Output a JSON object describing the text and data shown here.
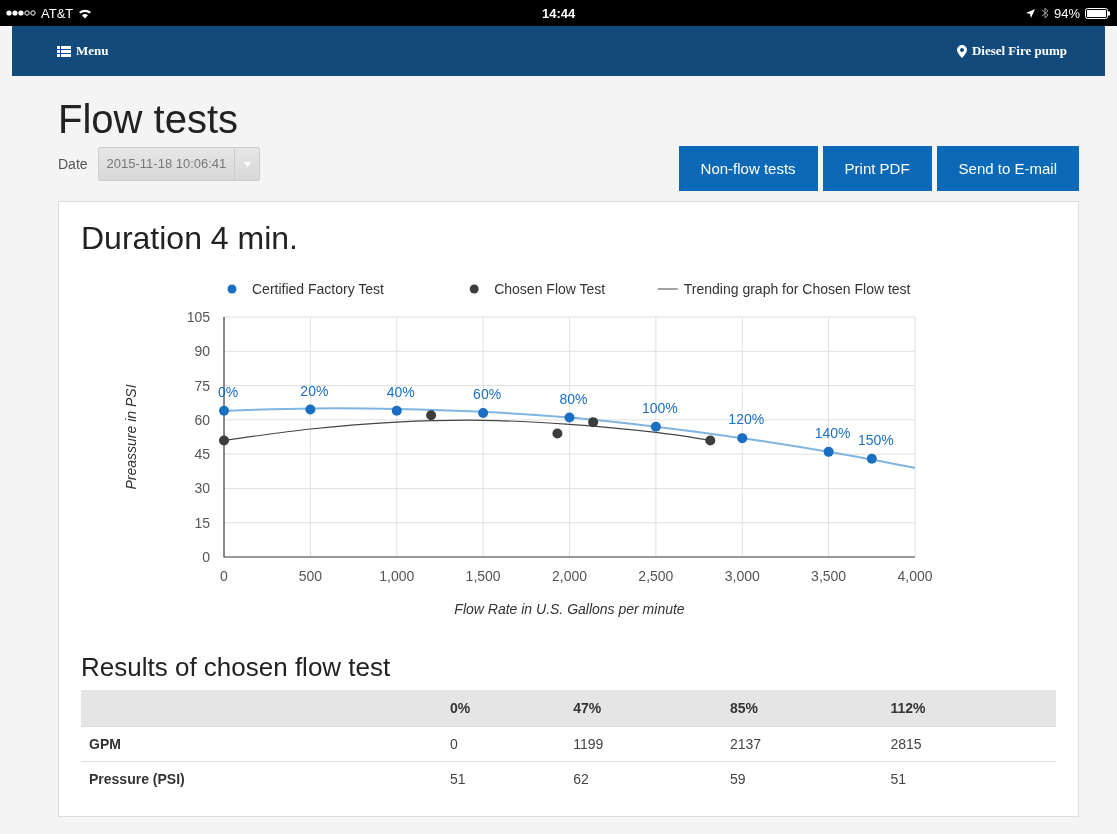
{
  "status_bar": {
    "carrier": "AT&T",
    "time": "14:44",
    "battery": "94%"
  },
  "navbar": {
    "menu": "Menu",
    "location": "Diesel Fire pump"
  },
  "page": {
    "title": "Flow tests",
    "date_label": "Date",
    "date_value": "2015-11-18 10:06:41",
    "buttons": [
      "Non-flow tests",
      "Print PDF",
      "Send to E-mail"
    ]
  },
  "card": {
    "heading": "Duration 4 min.",
    "chart_data": {
      "type": "scatter",
      "grid": true,
      "legend": "top",
      "xlabel": "Flow Rate in U.S. Gallons per minute",
      "ylabel": "Preassure in PSI",
      "xlim": [
        0,
        4000
      ],
      "ylim": [
        0,
        105
      ],
      "xticks": [
        {
          "value": 0,
          "label": "0"
        },
        {
          "value": 500,
          "label": "500"
        },
        {
          "value": 1000,
          "label": "1,000"
        },
        {
          "value": 1500,
          "label": "1,500"
        },
        {
          "value": 2000,
          "label": "2,000"
        },
        {
          "value": 2500,
          "label": "2,500"
        },
        {
          "value": 3000,
          "label": "3,000"
        },
        {
          "value": 3500,
          "label": "3,500"
        },
        {
          "value": 4000,
          "label": "4,000"
        }
      ],
      "yticks": [
        0,
        15,
        30,
        45,
        60,
        75,
        90,
        105
      ],
      "series": [
        {
          "type": "line",
          "color": "#7fb5e0",
          "x": [
            0,
            500,
            1000,
            1500,
            2000,
            2500,
            3000,
            3500,
            4000
          ],
          "values": [
            64,
            65,
            64.8,
            63.5,
            61,
            57,
            52,
            46,
            39
          ]
        },
        {
          "name": "Certified Factory Test",
          "type": "scatter",
          "color": "#1a6fc2",
          "x": [
            0,
            500,
            1000,
            1500,
            2000,
            2500,
            3000,
            3500,
            3750
          ],
          "values": [
            64,
            64.5,
            64,
            63,
            61,
            57,
            52,
            46,
            43
          ]
        },
        {
          "name": "Chosen Flow Test",
          "type": "scatter",
          "color": "#3d3d3d",
          "x": [
            0,
            1199,
            1930,
            2137,
            2815
          ],
          "values": [
            51,
            62,
            54,
            59,
            51
          ]
        },
        {
          "name": "Trending graph for Chosen Flow test",
          "type": "line",
          "color": "#444444",
          "x": [
            0,
            500,
            1000,
            1500,
            2000,
            2500,
            2815
          ],
          "values": [
            51,
            56,
            59,
            59.8,
            58,
            54.5,
            51
          ]
        }
      ],
      "annotations": [
        {
          "x": 0,
          "y": 64,
          "text": "0%"
        },
        {
          "x": 500,
          "y": 64.5,
          "text": "20%"
        },
        {
          "x": 1000,
          "y": 64,
          "text": "40%"
        },
        {
          "x": 1500,
          "y": 63,
          "text": "60%"
        },
        {
          "x": 2000,
          "y": 61,
          "text": "80%"
        },
        {
          "x": 2500,
          "y": 57,
          "text": "100%"
        },
        {
          "x": 3000,
          "y": 52,
          "text": "120%"
        },
        {
          "x": 3500,
          "y": 46,
          "text": "140%"
        },
        {
          "x": 3750,
          "y": 43,
          "text": "150%"
        }
      ]
    },
    "results": {
      "heading": "Results of chosen flow test",
      "columns": [
        "0%",
        "47%",
        "85%",
        "112%"
      ],
      "rows": [
        {
          "label": "GPM",
          "cells": [
            "0",
            "1199",
            "2137",
            "2815"
          ]
        },
        {
          "label": "Pressure (PSI)",
          "cells": [
            "51",
            "62",
            "59",
            "51"
          ]
        }
      ]
    }
  }
}
